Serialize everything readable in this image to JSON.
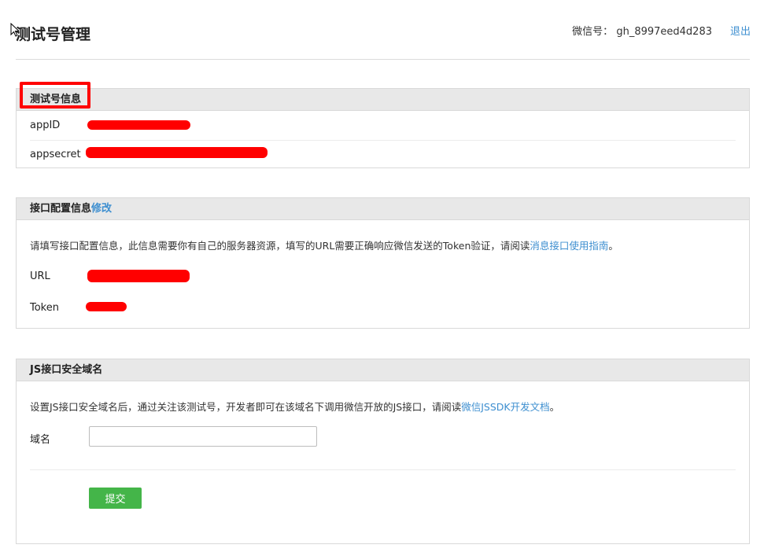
{
  "header": {
    "title": "测试号管理",
    "account_label": "微信号：",
    "account_value": "gh_8997eed4d283",
    "logout_label": "退出"
  },
  "test_account_panel": {
    "title": "测试号信息",
    "rows": [
      {
        "label": "appID"
      },
      {
        "label": "appsecret"
      }
    ]
  },
  "interface_panel": {
    "title": "接口配置信息",
    "edit_label": "修改",
    "description_prefix": "请填写接口配置信息，此信息需要你有自己的服务器资源，填写的URL需要正确响应微信发送的Token验证，请阅读",
    "description_link": "消息接口使用指南",
    "description_suffix": "。",
    "rows": [
      {
        "label": "URL"
      },
      {
        "label": "Token"
      }
    ]
  },
  "js_panel": {
    "title": "JS接口安全域名",
    "description_prefix": "设置JS接口安全域名后，通过关注该测试号，开发者即可在该域名下调用微信开放的JS接口，请阅读",
    "description_link": "微信JSSDK开发文档",
    "description_suffix": "。",
    "domain_label": "域名",
    "domain_value": "",
    "submit_label": "提交"
  },
  "colors": {
    "link": "#3e8fd0",
    "submit": "#44b549",
    "redaction": "#ff0000",
    "highlight_box": "#ff0000"
  }
}
